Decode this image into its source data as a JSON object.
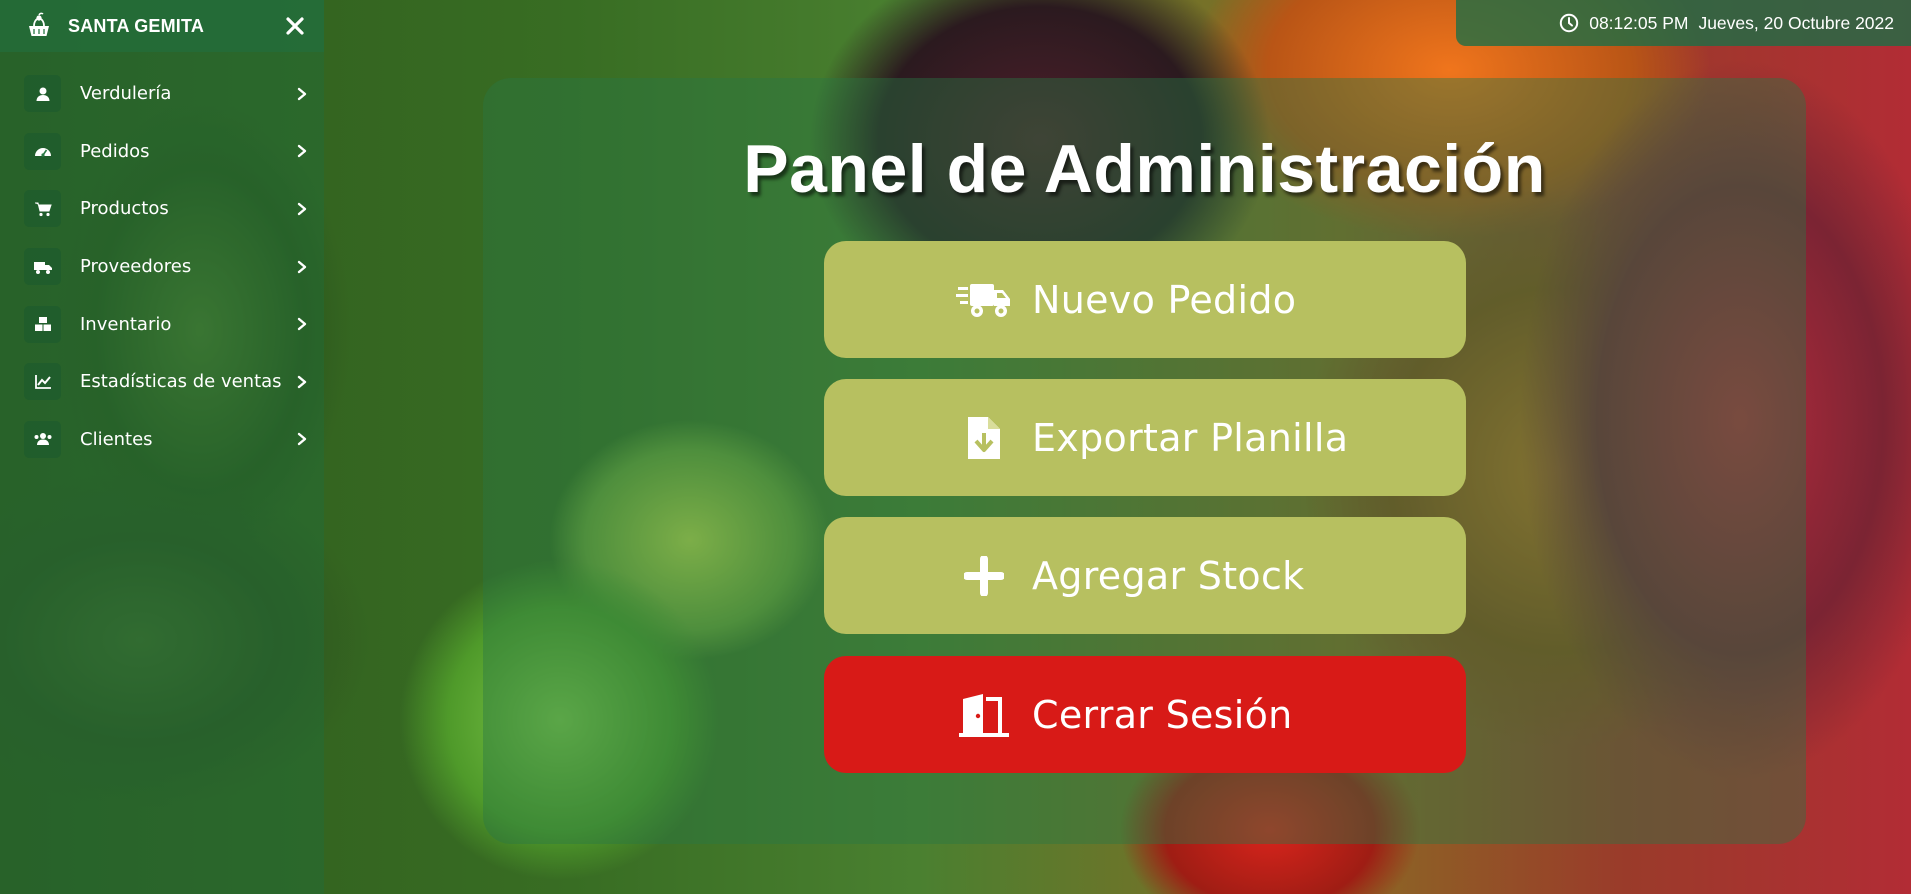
{
  "app": {
    "brand": "SANTA GEMITA",
    "brand_icon": "produce-basket-icon"
  },
  "sidebar": {
    "close_icon": "close-icon",
    "items": [
      {
        "label": "Verdulería",
        "icon": "user-icon"
      },
      {
        "label": "Pedidos",
        "icon": "dashboard-gauge-icon"
      },
      {
        "label": "Productos",
        "icon": "shopping-cart-icon"
      },
      {
        "label": "Proveedores",
        "icon": "truck-icon"
      },
      {
        "label": "Inventario",
        "icon": "boxes-icon"
      },
      {
        "label": "Estadísticas de ventas",
        "icon": "chart-line-icon"
      },
      {
        "label": "Clientes",
        "icon": "users-icon"
      }
    ]
  },
  "clock": {
    "time": "08:12:05 PM",
    "date": "Jueves, 20 Octubre 2022"
  },
  "panel": {
    "title": "Panel de Administración",
    "actions": [
      {
        "label": "Nuevo Pedido",
        "icon": "fast-truck-icon",
        "color": "#b7c060"
      },
      {
        "label": "Exportar Planilla",
        "icon": "file-download-icon",
        "color": "#b7c060"
      },
      {
        "label": "Agregar Stock",
        "icon": "plus-icon",
        "color": "#b7c060"
      },
      {
        "label": "Cerrar Sesión",
        "icon": "door-exit-icon",
        "color": "#d81a17"
      }
    ]
  },
  "theme": {
    "sidebar_green": "#2a7a45",
    "accent_olive": "#b7c060",
    "danger_red": "#d81a17"
  }
}
